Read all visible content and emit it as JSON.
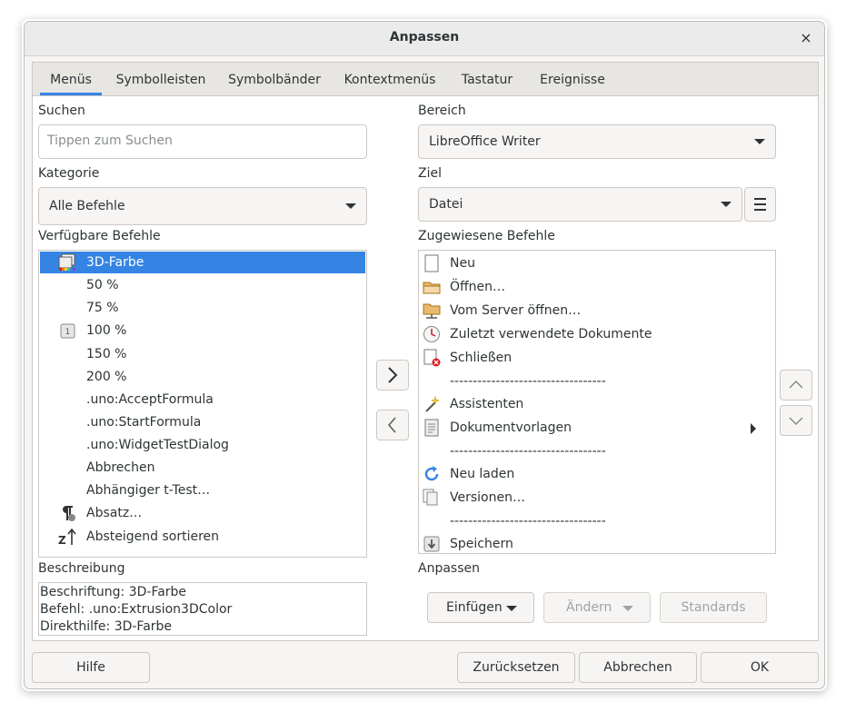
{
  "window": {
    "title": "Anpassen",
    "close": "×"
  },
  "tabs": [
    "Menüs",
    "Symbolleisten",
    "Symbolbänder",
    "Kontextmenüs",
    "Tastatur",
    "Ereignisse"
  ],
  "left": {
    "search_label": "Suchen",
    "search_placeholder": "Tippen zum Suchen",
    "category_label": "Kategorie",
    "category_value": "Alle Befehle",
    "available_label": "Verfügbare Befehle",
    "commands": [
      {
        "label": "3D-Farbe",
        "icon": "3d-color-icon",
        "selected": true
      },
      {
        "label": "50 %",
        "icon": ""
      },
      {
        "label": "75 %",
        "icon": ""
      },
      {
        "label": "100 %",
        "icon": "zoom-100-icon"
      },
      {
        "label": "150 %",
        "icon": ""
      },
      {
        "label": "200 %",
        "icon": ""
      },
      {
        "label": ".uno:AcceptFormula",
        "icon": ""
      },
      {
        "label": ".uno:StartFormula",
        "icon": ""
      },
      {
        "label": ".uno:WidgetTestDialog",
        "icon": ""
      },
      {
        "label": "Abbrechen",
        "icon": ""
      },
      {
        "label": "Abhängiger t-Test…",
        "icon": ""
      },
      {
        "label": "Absatz…",
        "icon": "paragraph-icon"
      },
      {
        "label": "Absteigend sortieren",
        "icon": "sort-descending-icon"
      }
    ],
    "description_label": "Beschreibung",
    "description": [
      "Beschriftung: 3D-Farbe",
      "Befehl: .uno:Extrusion3DColor",
      "Direkthilfe: 3D-Farbe"
    ]
  },
  "right": {
    "scope_label": "Bereich",
    "scope_value": "LibreOffice Writer",
    "target_label": "Ziel",
    "target_value": "Datei",
    "assigned_label": "Zugewiesene Befehle",
    "assigned": [
      {
        "label": "Neu",
        "icon": "new-document-icon"
      },
      {
        "label": "Öffnen…",
        "icon": "open-folder-icon"
      },
      {
        "label": "Vom Server öffnen…",
        "icon": "remote-folder-icon"
      },
      {
        "label": "Zuletzt verwendete Dokumente",
        "icon": "recent-documents-icon"
      },
      {
        "label": "Schließen",
        "icon": "close-document-icon"
      },
      {
        "label": "----------------------------------",
        "icon": "",
        "separator": true
      },
      {
        "label": "Assistenten",
        "icon": "wizard-icon"
      },
      {
        "label": "Dokumentvorlagen",
        "icon": "templates-icon",
        "submenu": true
      },
      {
        "label": "----------------------------------",
        "icon": "",
        "separator": true
      },
      {
        "label": "Neu laden",
        "icon": "reload-icon"
      },
      {
        "label": "Versionen…",
        "icon": "versions-icon"
      },
      {
        "label": "----------------------------------",
        "icon": "",
        "separator": true
      },
      {
        "label": "Speichern",
        "icon": "save-icon"
      }
    ],
    "customize_label": "Anpassen",
    "insert_button": "Einfügen",
    "modify_button": "Ändern",
    "defaults_button": "Standards"
  },
  "footer": {
    "help": "Hilfe",
    "reset": "Zurücksetzen",
    "cancel": "Abbrechen",
    "ok": "OK"
  }
}
